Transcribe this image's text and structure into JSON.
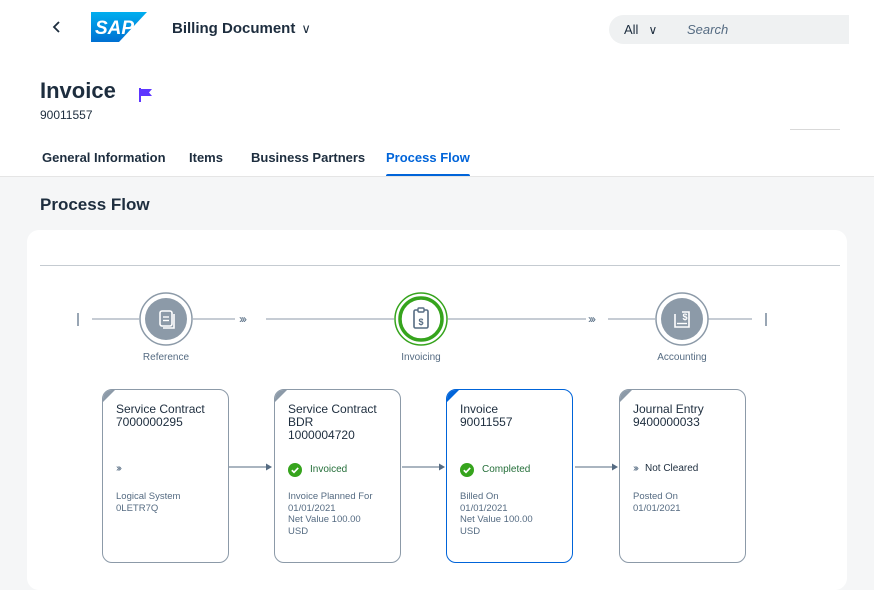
{
  "shell": {
    "back_icon": "chevron-left-icon",
    "logo_text": "SAP",
    "app_title": "Billing Document",
    "app_title_chevron": "∨",
    "search_scope": "All",
    "search_scope_chevron": "∨",
    "search_placeholder": "Search"
  },
  "header": {
    "title": "Invoice",
    "subtitle": "90011557",
    "flag_color": "#5d36ff"
  },
  "tabs": [
    {
      "label": "General Information",
      "selected": false
    },
    {
      "label": "Items",
      "selected": false
    },
    {
      "label": "Business Partners",
      "selected": false
    },
    {
      "label": "Process Flow",
      "selected": true
    }
  ],
  "section": {
    "title": "Process Flow"
  },
  "lanes": [
    {
      "label": "Reference",
      "icon": "document-icon",
      "active": false
    },
    {
      "label": "Invoicing",
      "icon": "invoice-icon",
      "active": true
    },
    {
      "label": "Accounting",
      "icon": "accounting-document-icon",
      "active": false
    }
  ],
  "lane_connector_glyph": "›››",
  "nodes": [
    {
      "title_lines": [
        "Service Contract",
        "7000000295"
      ],
      "status": "",
      "status_glyph": "›››",
      "info_lines": [
        "Logical System",
        "0LETR7Q"
      ]
    },
    {
      "title_lines": [
        "Service Contract",
        "BDR",
        "1000004720"
      ],
      "status": "Invoiced",
      "status_glyph": "✓",
      "info_lines": [
        "Invoice Planned For",
        "01/01/2021",
        "Net Value 100.00",
        "USD"
      ]
    },
    {
      "title_lines": [
        "Invoice",
        "90011557"
      ],
      "status": "Completed",
      "status_glyph": "✓",
      "info_lines": [
        "Billed On",
        "01/01/2021",
        "Net Value 100.00",
        "USD"
      ]
    },
    {
      "title_lines": [
        "Journal Entry",
        "9400000033"
      ],
      "status": "Not Cleared",
      "status_glyph": "›››",
      "info_lines": [
        "Posted On",
        "01/01/2021"
      ]
    }
  ],
  "colors": {
    "accent": "#0064d9",
    "positive": "#256f3a",
    "positive_icon": "#36a41d",
    "neutral": "#8c9aa8"
  }
}
